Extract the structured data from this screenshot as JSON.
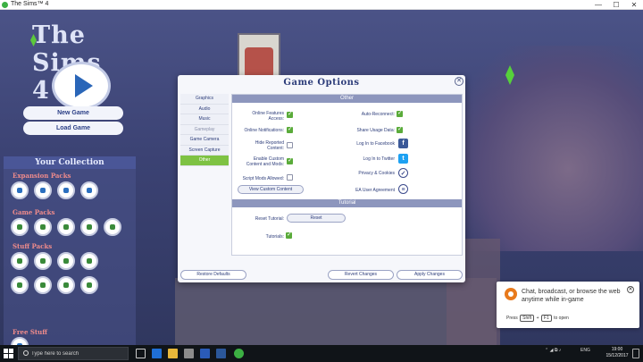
{
  "window": {
    "title": "The Sims™ 4"
  },
  "logo": "The Sims 4",
  "main_menu": {
    "new_game": "New Game",
    "load_game": "Load Game"
  },
  "collection": {
    "title": "Your Collection",
    "categories": [
      "Expansion Packs",
      "Game Packs",
      "Stuff Packs",
      "Free Stuff"
    ]
  },
  "dialog": {
    "title": "Game Options",
    "tabs": [
      "Graphics",
      "Audio",
      "Music",
      "Gameplay",
      "Game Camera",
      "Screen Capture",
      "Other"
    ],
    "active_tab": "Other",
    "other": {
      "heading": "Other",
      "left": [
        {
          "label": "Online Features Access:",
          "checked": true
        },
        {
          "label": "Online Notifications:",
          "checked": true
        },
        {
          "label": "Hide Reported Content:",
          "checked": false
        },
        {
          "label": "Enable Custom Content and Mods:",
          "checked": true
        },
        {
          "label": "Script Mods Allowed:",
          "checked": false
        }
      ],
      "view_custom_content": "View Custom Content",
      "right": [
        {
          "label": "Auto-Reconnect:",
          "checked": true
        },
        {
          "label": "Share Usage Data:",
          "checked": true
        },
        {
          "label": "Log In to Facebook",
          "icon": "facebook-icon"
        },
        {
          "label": "Log In to Twitter",
          "icon": "twitter-icon"
        },
        {
          "label": "Privacy & Cookies",
          "icon": "shield-check-icon"
        },
        {
          "label": "EA User Agreement",
          "icon": "document-icon"
        }
      ]
    },
    "tutorial": {
      "heading": "Tutorial",
      "reset_label": "Reset Tutorial:",
      "reset_button": "Reset",
      "tutorials_label": "Tutorials:",
      "tutorials_checked": true
    },
    "footer": {
      "restore_defaults": "Restore Defaults",
      "revert_changes": "Revert Changes",
      "apply_changes": "Apply Changes"
    }
  },
  "notification": {
    "text": "Chat, broadcast, or browse the web anytime while in-game",
    "press": "Press",
    "key1": "Shift",
    "plus": "+",
    "key2": "F1",
    "to_open": "to open"
  },
  "taskbar": {
    "search_placeholder": "Type here to search",
    "language": "ENG",
    "time": "19:00",
    "date": "15/12/2017"
  },
  "colors": {
    "active_tab": "#7ec243",
    "dialog_title": "#2d3d7a",
    "checkbox_on": "#5aab3a",
    "facebook": "#3b5998",
    "twitter": "#1da1f2"
  }
}
